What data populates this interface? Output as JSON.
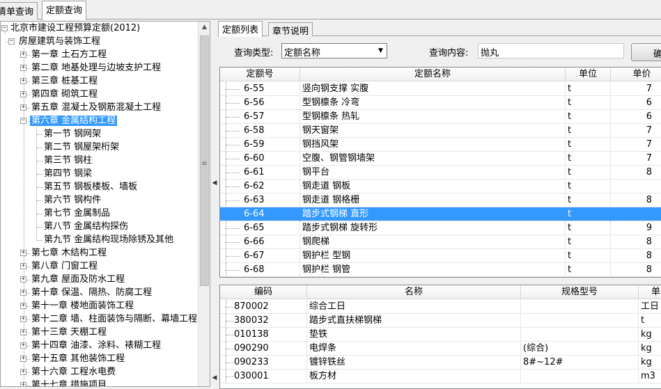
{
  "top_tabs": [
    "清单查询",
    "定额查询"
  ],
  "tree": {
    "root": "北京市建设工程预算定额(2012)",
    "group": "房屋建筑与装饰工程",
    "chapters_before": [
      "第一章 土石方工程",
      "第二章 地基处理与边坡支护工程",
      "第三章 桩基工程",
      "第四章 砌筑工程",
      "第五章 混凝土及钢筋混凝土工程"
    ],
    "selected_chapter": "第六章 金属结构工程",
    "sections": [
      "第一节 钢网架",
      "第二节 钢屋架桁架",
      "第三节 钢柱",
      "第四节 钢梁",
      "第五节 钢板楼板、墙板",
      "第六节 钢构件",
      "第七节 金属制品",
      "第八节 金属结构探伤",
      "第九节 金属结构现场除锈及其他"
    ],
    "chapters_after": [
      "第七章 木结构工程",
      "第八章 门窗工程",
      "第九章 屋面及防水工程",
      "第十章 保温、隔热、防腐工程",
      "第十一章 楼地面装饰工程",
      "第十二章 墙、柱面装饰与隔断、幕墙工程",
      "第十三章 天棚工程",
      "第十四章 油漆、涂料、裱糊工程",
      "第十五章 其他装饰工程",
      "第十六章 工程水电费",
      "第十七章 措施项目"
    ]
  },
  "right_tabs": [
    "定额列表",
    "章节说明"
  ],
  "query": {
    "type_label": "查询类型:",
    "type_value": "定额名称",
    "content_label": "查询内容:",
    "content_value": "抛丸",
    "button_label": "确定"
  },
  "quota_table": {
    "headers": [
      "定额号",
      "定额名称",
      "单位",
      "单价"
    ],
    "selected_index": 9,
    "rows": [
      [
        "6-55",
        "竖向钢支撑 实腹",
        "t",
        "7"
      ],
      [
        "6-56",
        "型钢檩条 冷弯",
        "t",
        "6"
      ],
      [
        "6-57",
        "型钢檩条 热轧",
        "t",
        "6"
      ],
      [
        "6-58",
        "钢天窗架",
        "t",
        "7"
      ],
      [
        "6-59",
        "钢挡风架",
        "t",
        "7"
      ],
      [
        "6-60",
        "空腹、钢管钢墙架",
        "t",
        "7"
      ],
      [
        "6-61",
        "钢平台",
        "t",
        "8"
      ],
      [
        "6-62",
        "钢走道 钢板",
        "t",
        ""
      ],
      [
        "6-63",
        "钢走道 钢格栅",
        "t",
        "8"
      ],
      [
        "6-64",
        "踏步式钢梯 直形",
        "t",
        ""
      ],
      [
        "6-65",
        "踏步式钢梯 旋转形",
        "t",
        "9"
      ],
      [
        "6-66",
        "钢爬梯",
        "t",
        "8"
      ],
      [
        "6-67",
        "钢护栏 型钢",
        "t",
        "8"
      ],
      [
        "6-68",
        "钢护栏 钢管",
        "t",
        "8"
      ]
    ]
  },
  "material_table": {
    "headers": [
      "编码",
      "名称",
      "规格型号",
      "单"
    ],
    "rows": [
      [
        "870002",
        "综合工日",
        "",
        "工日"
      ],
      [
        "380032",
        "踏步式直扶梯钢梯",
        "",
        "t"
      ],
      [
        "010138",
        "垫铁",
        "",
        "kg"
      ],
      [
        "090290",
        "电焊条",
        "(综合)",
        "kg"
      ],
      [
        "090233",
        "镀锌铁丝",
        "8#~12#",
        "kg"
      ],
      [
        "030001",
        "板方材",
        "",
        "m3"
      ]
    ]
  },
  "colors": {
    "selection": "#3399ff"
  }
}
